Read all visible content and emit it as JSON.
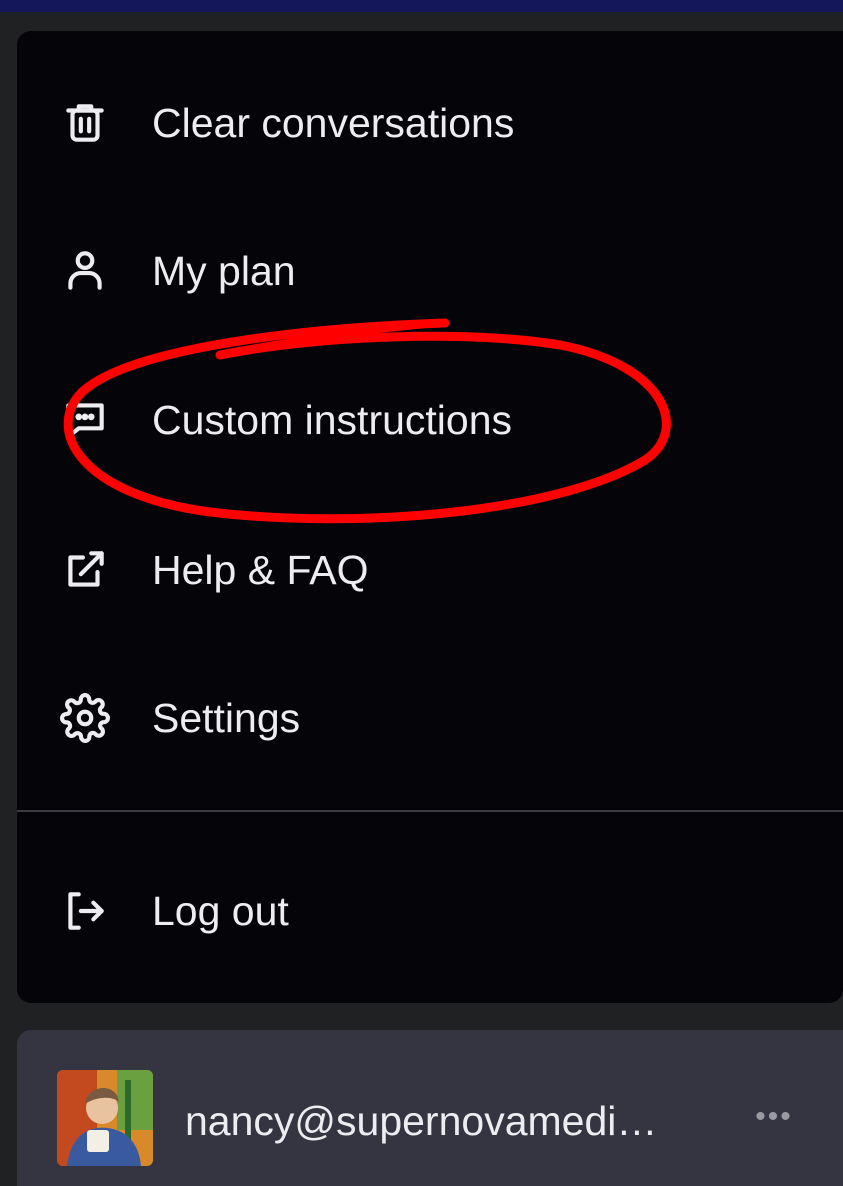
{
  "menu": {
    "items": [
      {
        "label": "Clear conversations",
        "icon": "trash-icon"
      },
      {
        "label": "My plan",
        "icon": "user-icon"
      },
      {
        "label": "Custom instructions",
        "icon": "chat-bubble-icon"
      },
      {
        "label": "Help & FAQ",
        "icon": "external-link-icon"
      },
      {
        "label": "Settings",
        "icon": "gear-icon"
      }
    ],
    "logout": {
      "label": "Log out",
      "icon": "logout-icon"
    }
  },
  "account": {
    "email": "nancy@supernovamedi…",
    "more_label": "•••"
  },
  "colors": {
    "menu_background": "#050509",
    "sidebar_background": "#202123",
    "account_background": "#343541",
    "text": "#ececf1",
    "annotation_red": "#ff0000"
  }
}
